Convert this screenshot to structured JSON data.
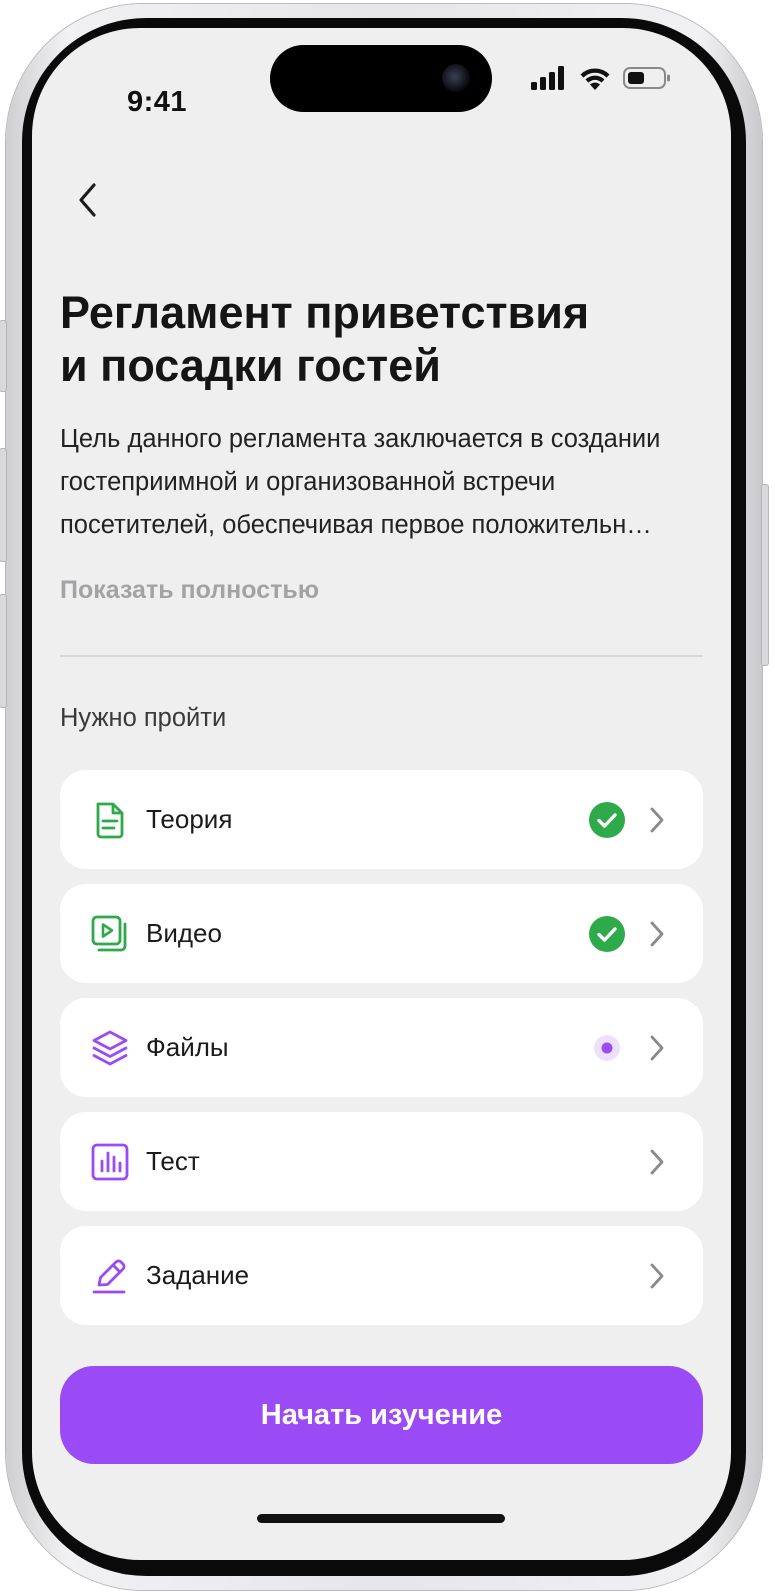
{
  "status_bar": {
    "time": "9:41",
    "icons": [
      "signal-icon",
      "wifi-icon",
      "battery-icon"
    ]
  },
  "nav": {
    "back_icon": "chevron-left-icon"
  },
  "page": {
    "title_line1": "Регламент приветствия",
    "title_line2": "и посадки гостей",
    "description": "Цель данного регламента заключается в создании гостеприимной и организованной встречи посетителей, обеспечивая первое положительн…",
    "show_more": "Показать полностью",
    "section_title": "Нужно пройти"
  },
  "items": [
    {
      "label": "Теория",
      "icon": "document-icon",
      "status": "completed"
    },
    {
      "label": "Видео",
      "icon": "video-icon",
      "status": "completed"
    },
    {
      "label": "Файлы",
      "icon": "layers-icon",
      "status": "in-progress"
    },
    {
      "label": "Тест",
      "icon": "chart-icon",
      "status": "none"
    },
    {
      "label": "Задание",
      "icon": "pencil-icon",
      "status": "none"
    }
  ],
  "cta": {
    "label": "Начать изучение"
  },
  "colors": {
    "accent": "#9b4bf5",
    "success": "#2eaa4a",
    "background": "#efeff0",
    "card": "#ffffff"
  }
}
